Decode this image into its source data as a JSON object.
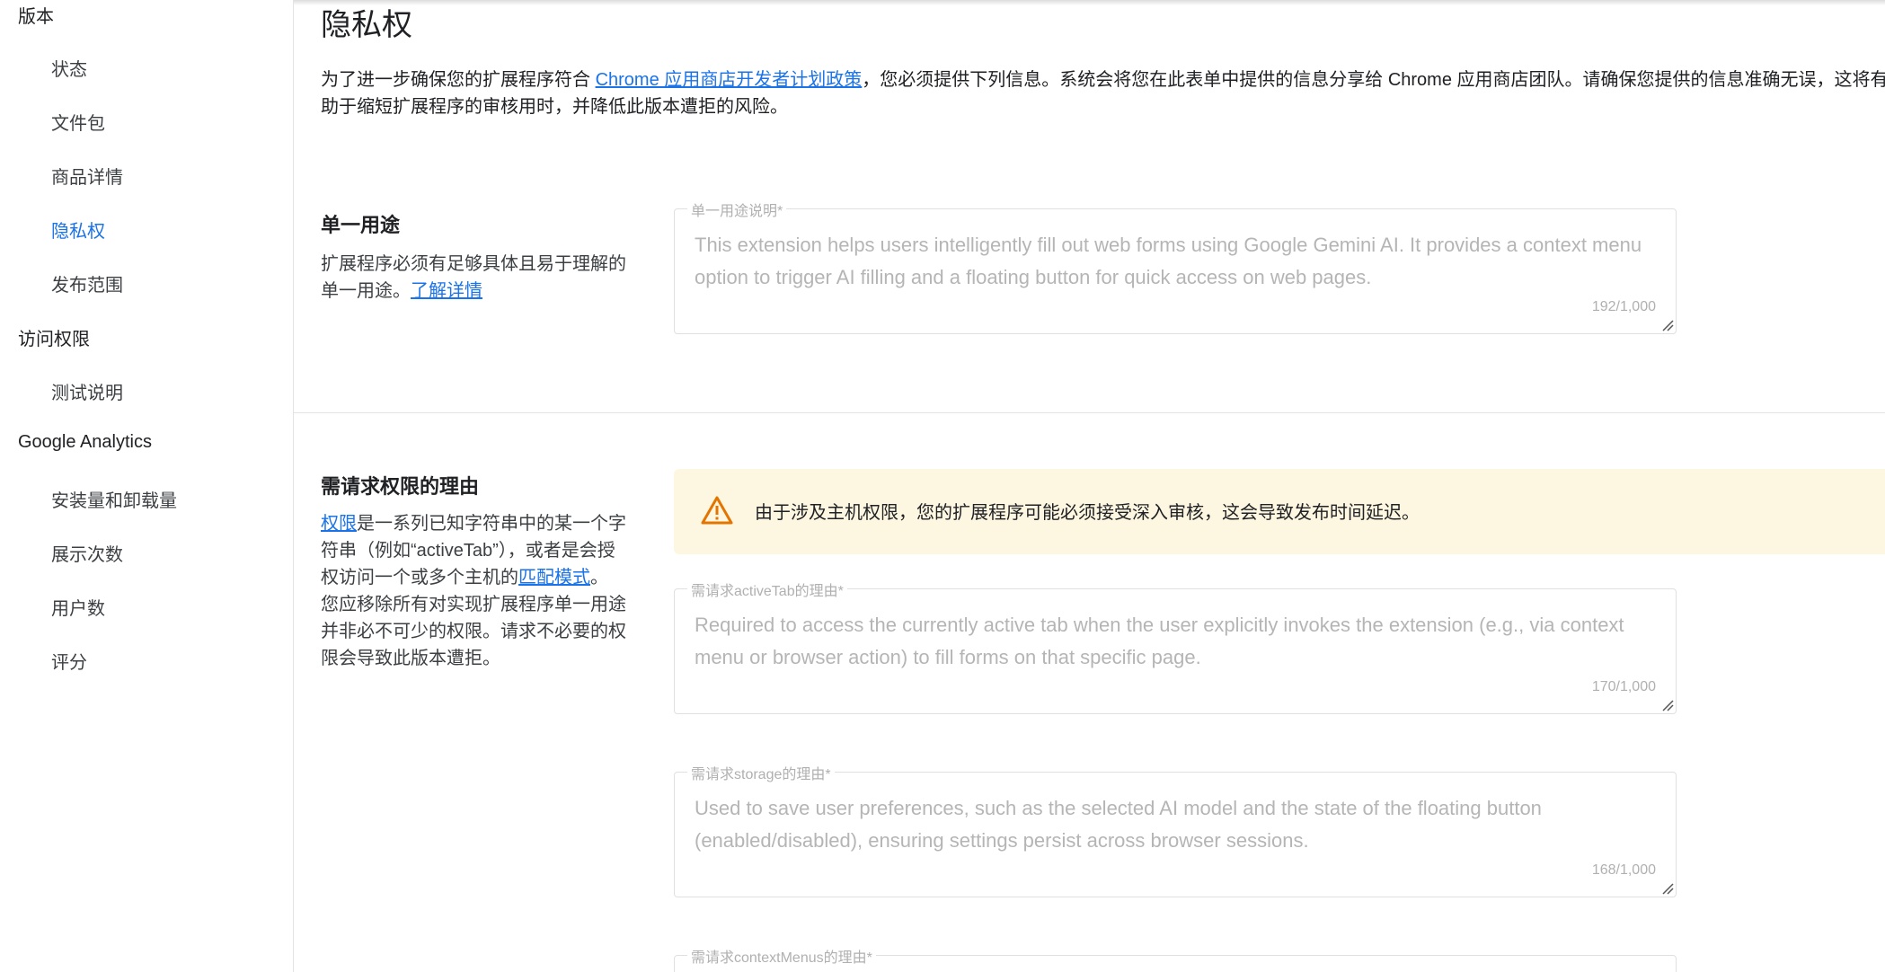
{
  "sidebar": {
    "version_label": "版本",
    "items_build": [
      {
        "label": "状态"
      },
      {
        "label": "文件包"
      },
      {
        "label": "商品详情"
      },
      {
        "label": "隐私权"
      },
      {
        "label": "发布范围"
      }
    ],
    "access_label": "访问权限",
    "items_access": [
      {
        "label": "测试说明"
      }
    ],
    "analytics_label": "Google Analytics",
    "items_analytics": [
      {
        "label": "安装量和卸载量"
      },
      {
        "label": "展示次数"
      },
      {
        "label": "用户数"
      },
      {
        "label": "评分"
      }
    ]
  },
  "main": {
    "title": "隐私权",
    "intro": {
      "prefix": "为了进一步确保您的扩展程序符合 ",
      "link": "Chrome 应用商店开发者计划政策",
      "suffix": "，您必须提供下列信息。系统会将您在此表单中提供的信息分享给 Chrome 应用商店团队。请确保您提供的信息准确无误，这将有助于缩短扩展程序的审核用时，并降低此版本遭拒的风险。"
    },
    "single_purpose": {
      "title": "单一用途",
      "desc": "扩展程序必须有足够具体且易于理解的单一用途。",
      "learn_more": "了解详情",
      "field_label": "单一用途说明*",
      "field_value": "This extension helps users intelligently fill out web forms using Google Gemini AI. It provides a context menu option to trigger AI filling and a floating button for quick access on web pages.",
      "count": "192/1,000"
    },
    "permissions": {
      "title": "需请求权限的理由",
      "desc_link1": "权限",
      "desc_part1": "是一系列已知字符串中的某一个字符串（例如“activeTab”），或者是会授权访问一个或多个主机的",
      "desc_link2": "匹配模式",
      "desc_part2": "。",
      "desc_part3": "您应移除所有对实现扩展程序单一用途并非必不可少的权限。请求不必要的权限会导致此版本遭拒。",
      "warning": "由于涉及主机权限，您的扩展程序可能必须接受深入审核，这会导致发布时间延迟。",
      "warning_color": "#e37400",
      "fields": [
        {
          "label": "需请求activeTab的理由*",
          "value": "Required to access the currently active tab when the user explicitly invokes the extension (e.g., via context menu or browser action) to fill forms on that specific page.",
          "count": "170/1,000"
        },
        {
          "label": "需请求storage的理由*",
          "value": "Used to save user preferences, such as the selected AI model and the state of the floating button (enabled/disabled), ensuring settings persist across browser sessions.",
          "count": "168/1,000"
        },
        {
          "label": "需请求contextMenus的理由*"
        }
      ]
    }
  },
  "colors": {
    "accent": "#1a73e8",
    "warning_bg": "#fdf7e1"
  }
}
